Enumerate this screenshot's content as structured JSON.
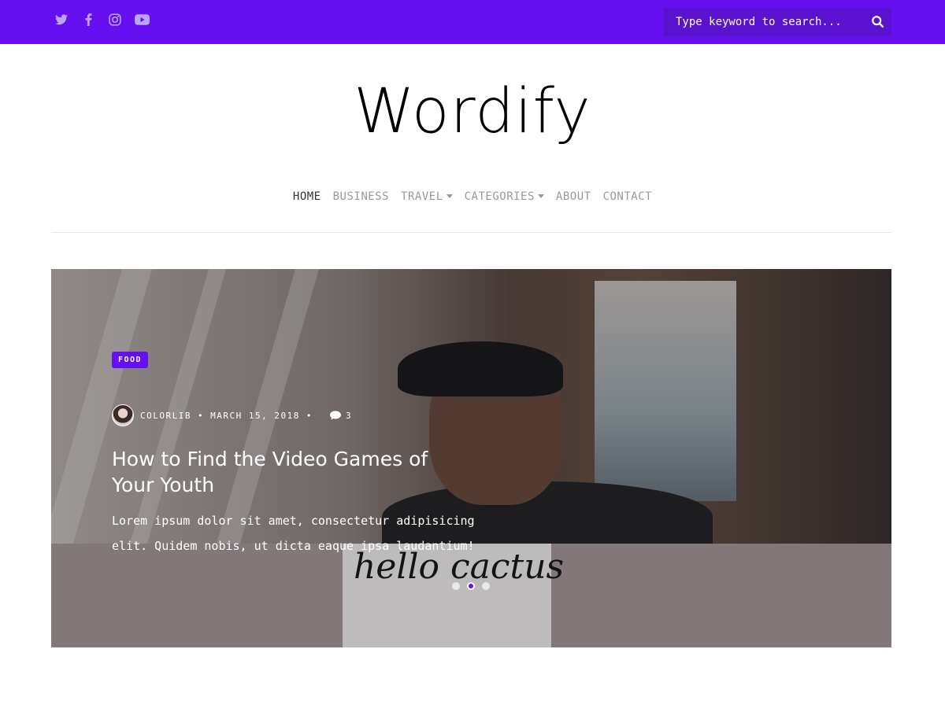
{
  "topbar": {
    "socials": [
      {
        "name": "twitter-icon"
      },
      {
        "name": "facebook-icon"
      },
      {
        "name": "instagram-icon"
      },
      {
        "name": "youtube-icon"
      }
    ],
    "search": {
      "placeholder": "Type keyword to search..."
    }
  },
  "site": {
    "logo": "Wordify"
  },
  "nav": {
    "items": [
      {
        "label": "HOME",
        "active": true
      },
      {
        "label": "BUSINESS"
      },
      {
        "label": "TRAVEL",
        "dropdown": true
      },
      {
        "label": "CATEGORIES",
        "dropdown": true
      },
      {
        "label": "ABOUT"
      },
      {
        "label": "CONTACT"
      }
    ]
  },
  "hero": {
    "category": "FOOD",
    "author": "COLORLIB",
    "separator": "•",
    "date": "MARCH 15, 2018",
    "comments": "3",
    "title": "How to Find the Video Games of Your Youth",
    "excerpt": "Lorem ipsum dolor sit amet, consectetur adipisicing elit. Quidem nobis, ut dicta eaque ipsa laudantium!",
    "mug_text": "hello cactus",
    "slides": {
      "count": 3,
      "active_index": 1
    }
  },
  "colors": {
    "brand": "#6610f2",
    "nav_active": "#333333",
    "nav_inactive": "#999999"
  }
}
